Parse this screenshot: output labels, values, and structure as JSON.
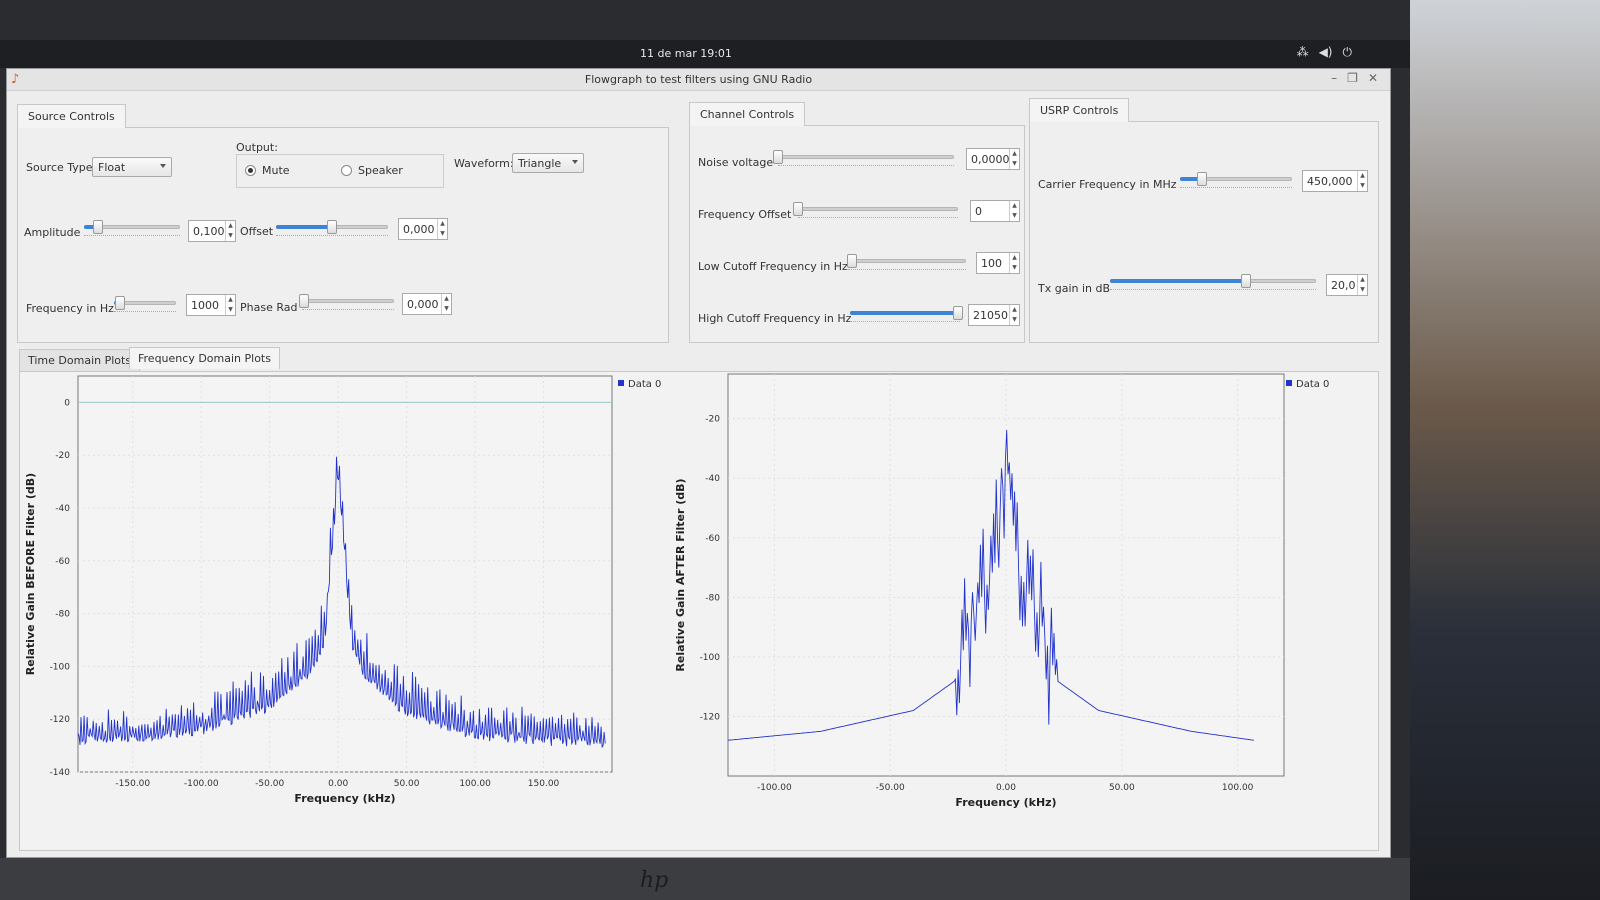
{
  "topbar": {
    "clock": "11 de mar  19:01"
  },
  "window": {
    "title": "Flowgraph to test filters using GNU Radio"
  },
  "source": {
    "tab": "Source Controls",
    "source_type_label": "Source Type:",
    "source_type_value": "Float",
    "output_label": "Output:",
    "mute_label": "Mute",
    "speaker_label": "Speaker",
    "waveform_label": "Waveform:",
    "waveform_value": "Triangle",
    "amplitude_label": "Amplitude",
    "amplitude_value": "0,100",
    "amplitude_level": 0.15,
    "offset_label": "Offset",
    "offset_value": "0,000",
    "offset_level": 0.5,
    "frequency_label": "Frequency in Hz",
    "frequency_value": "1000",
    "frequency_level": 0.1,
    "phase_label": "Phase Rad",
    "phase_value": "0,000",
    "phase_level": 0.02
  },
  "channel": {
    "tab": "Channel Controls",
    "noise_label": "Noise voltage",
    "noise_value": "0,0000",
    "noise_level": 0.0,
    "freq_offset_label": "Frequency Offset",
    "freq_offset_value": "0",
    "freq_offset_level": 0.0,
    "low_cutoff_label": "Low Cutoff Frequency in Hz",
    "low_cutoff_value": "100",
    "low_cutoff_level": 0.03,
    "high_cutoff_label": "High Cutoff Frequency in Hz",
    "high_cutoff_value": "21050",
    "high_cutoff_level": 0.98
  },
  "usrp": {
    "tab": "USRP Controls",
    "carrier_label": "Carrier Frequency in MHz",
    "carrier_value": "450,000",
    "carrier_level": 0.2,
    "txgain_label": "Tx gain in dB",
    "txgain_value": "20,0",
    "txgain_level": 0.66
  },
  "plots": {
    "tab_time": "Time Domain Plots",
    "tab_freq": "Frequency Domain Plots"
  },
  "chart_data": [
    {
      "type": "line",
      "legend": [
        "Data 0"
      ],
      "xlabel": "Frequency (kHz)",
      "ylabel": "Relative Gain BEFORE Filter (dB)",
      "xlim": [
        -190,
        200
      ],
      "ylim": [
        -140,
        10
      ],
      "x_ticks": [
        "-150.00",
        "-100.00",
        "-50.00",
        "0.00",
        "50.00",
        "100.00",
        "150.00"
      ],
      "y_ticks": [
        "0",
        "-20",
        "-40",
        "-60",
        "-80",
        "-100",
        "-120",
        "-140"
      ],
      "x": [
        -190,
        -150,
        -100,
        -50,
        -20,
        -10,
        0,
        10,
        20,
        50,
        100,
        150,
        195
      ],
      "series": [
        {
          "name": "Data 0",
          "values": [
            -128,
            -127,
            -124,
            -115,
            -102,
            -92,
            -27,
            -92,
            -104,
            -118,
            -126,
            -128,
            -129
          ]
        }
      ]
    },
    {
      "type": "line",
      "legend": [
        "Data 0"
      ],
      "xlabel": "Frequency (kHz)",
      "ylabel": "Relative Gain AFTER Filter (dB)",
      "xlim": [
        -120,
        120
      ],
      "ylim": [
        -140,
        -5
      ],
      "x_ticks": [
        "-100.00",
        "-50.00",
        "0.00",
        "50.00",
        "100.00"
      ],
      "y_ticks": [
        "-20",
        "-40",
        "-60",
        "-80",
        "-100",
        "-120"
      ],
      "x": [
        -120,
        -80,
        -40,
        -22,
        -15,
        -5,
        0,
        5,
        15,
        22,
        40,
        80,
        107
      ],
      "series": [
        {
          "name": "Data 0",
          "values": [
            -128,
            -125,
            -118,
            -108,
            -88,
            -70,
            -32,
            -70,
            -88,
            -108,
            -118,
            -125,
            -128
          ]
        }
      ]
    }
  ]
}
